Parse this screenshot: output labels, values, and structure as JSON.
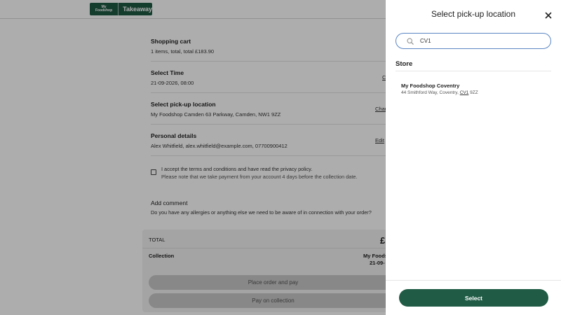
{
  "logo": {
    "mark_line1": "My",
    "mark_line2": "Foodshop",
    "text": "Takeaway"
  },
  "cart": {
    "title": "Shopping cart",
    "summary": "1 items, total, total £183.90"
  },
  "time": {
    "title": "Select Time",
    "value": "21-09-2026, 08:00",
    "edit_label": "C"
  },
  "pickup": {
    "title": "Select pick-up location",
    "value": "My Foodshop Camden 63 Parkway, Camden, NW1 9ZZ",
    "edit_label": "Char"
  },
  "personal": {
    "title": "Personal details",
    "value": "Alex Whitfield, alex.whitfield@example.com, 07700900412",
    "edit_label": "Edit"
  },
  "terms": {
    "text": "I accept the terms and conditions and have read the privacy policy.",
    "note": "Please note that we take payment from your account 4 days before the collection date."
  },
  "comment": {
    "title": "Add comment",
    "prompt": "Do you have any allergies or anything else we need to be aware of in connection with your order?"
  },
  "summary": {
    "total_label": "TOTAL",
    "total_amount": "£",
    "collection_label": "Collection",
    "collection_store": "My Foods",
    "collection_date": "21-09-",
    "place_order_label": "Place order and pay",
    "pay_on_collection_label": "Pay on collection"
  },
  "drawer": {
    "title": "Select pick-up location",
    "search_value": "CV1",
    "store_heading": "Store",
    "stores": [
      {
        "name": "My Foodshop Coventry",
        "addr_before": "44 Smithford Way, Coventry, ",
        "addr_match": "CV1",
        "addr_after": " 9ZZ"
      }
    ],
    "select_label": "Select"
  },
  "colors": {
    "brand": "#1f5b45",
    "search_border": "#5b86c4"
  }
}
